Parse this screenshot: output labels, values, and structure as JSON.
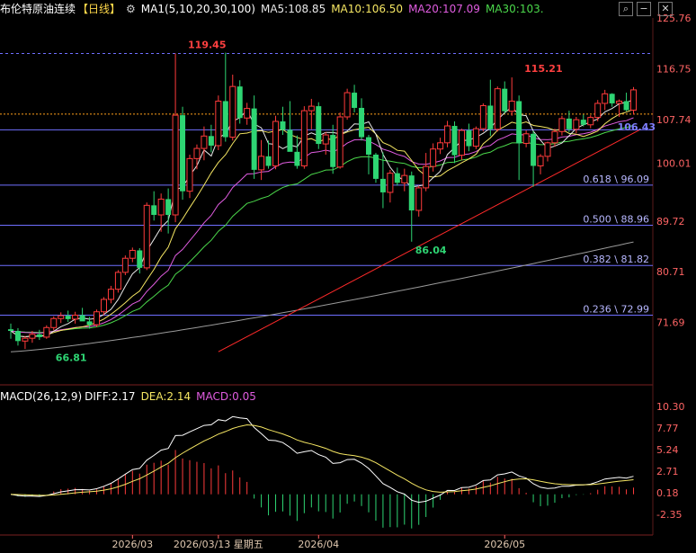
{
  "header": {
    "title": "布伦特原油连续",
    "period": "【日线】",
    "ma_indicator": "MA1(5,10,20,30,100)",
    "ma5": "MA5:108.85",
    "ma10": "MA10:106.50",
    "ma20": "MA20:107.09",
    "ma30": "MA30:103.",
    "macd_indicator": "MACD(26,12,9)",
    "diff": "DIFF:2.17",
    "dea": "DEA:2.14",
    "macd": "MACD:0.05"
  },
  "colors": {
    "up": "#ff3b3b",
    "down": "#2ed573",
    "ma5": "#e8e8e8",
    "ma10": "#f5e663",
    "ma20": "#e05ce0",
    "ma30": "#4bd84b",
    "ma100": "#9a9a9a",
    "fib": "#6f6fff",
    "dashed": "#ff9f1a",
    "trend": "#ff2a2a",
    "axis": "#ff6464"
  },
  "chart_data": [
    {
      "type": "candlestick",
      "y_axis_labels": [
        "125.76",
        "116.75",
        "107.74",
        "100.01",
        "89.72",
        "80.71",
        "71.69"
      ],
      "x_axis_labels": [
        "2026/03",
        "2026/03/13 星期五",
        "2026/04",
        "2026/05"
      ],
      "annotations": [
        {
          "text": "119.45",
          "x": 24,
          "y": 119.45,
          "color": "#ff4040"
        },
        {
          "text": "115.21",
          "x": 71,
          "y": 115.21,
          "color": "#ff4040"
        },
        {
          "text": "86.04",
          "x": 56,
          "y": 86.04,
          "color": "#2ed573"
        },
        {
          "text": "66.81",
          "x": 5,
          "y": 66.81,
          "color": "#2ed573"
        },
        {
          "text": "106.43",
          "x": 85,
          "y": 106.43,
          "color": "#7f7fff"
        }
      ],
      "fib_levels": [
        {
          "ratio": "0.618",
          "price": 96.09,
          "label": "0.618 \\ 96.09"
        },
        {
          "ratio": "0.500",
          "price": 88.96,
          "label": "0.500 \\ 88.96"
        },
        {
          "ratio": "0.382",
          "price": 81.82,
          "label": "0.382 \\ 81.82"
        },
        {
          "ratio": "0.236",
          "price": 72.99,
          "label": "0.236 \\ 72.99"
        }
      ],
      "reference_lines": {
        "high_line": 119.45,
        "dashed_line": 108.7,
        "upper_fib_line": 105.9
      },
      "trendline": [
        {
          "x": 29,
          "y": 66.5
        },
        {
          "x": 88,
          "y": 106.0
        }
      ],
      "candles": [
        [
          70.5,
          71.5,
          68.8,
          70.2
        ],
        [
          70.2,
          70.7,
          67.6,
          68.4
        ],
        [
          68.4,
          69.3,
          67.0,
          68.9
        ],
        [
          68.9,
          70.2,
          68.1,
          69.6
        ],
        [
          69.6,
          70.4,
          68.6,
          69.1
        ],
        [
          69.1,
          71.2,
          68.8,
          70.8
        ],
        [
          70.8,
          72.8,
          70.3,
          72.4
        ],
        [
          72.4,
          73.5,
          71.6,
          72.9
        ],
        [
          72.9,
          73.8,
          71.8,
          72.3
        ],
        [
          72.3,
          73.6,
          71.5,
          73.0
        ],
        [
          73.0,
          74.3,
          72.2,
          71.9
        ],
        [
          71.9,
          72.7,
          70.6,
          71.3
        ],
        [
          71.3,
          74.0,
          70.9,
          73.6
        ],
        [
          73.6,
          76.2,
          73.0,
          75.8
        ],
        [
          75.8,
          78.2,
          75.1,
          77.6
        ],
        [
          77.6,
          81.0,
          77.0,
          80.6
        ],
        [
          80.6,
          83.6,
          80.1,
          83.1
        ],
        [
          83.1,
          85.0,
          82.4,
          84.5
        ],
        [
          84.5,
          84.9,
          80.4,
          81.4
        ],
        [
          81.4,
          93.0,
          81.0,
          92.5
        ],
        [
          92.5,
          95.0,
          89.8,
          90.8
        ],
        [
          90.8,
          94.6,
          87.8,
          93.6
        ],
        [
          93.6,
          95.5,
          87.5,
          90.8
        ],
        [
          90.8,
          119.45,
          89.5,
          108.5
        ],
        [
          108.5,
          110.0,
          93.5,
          95.0
        ],
        [
          95.0,
          101.5,
          93.8,
          100.8
        ],
        [
          100.8,
          103.3,
          98.9,
          102.6
        ],
        [
          102.6,
          106.5,
          100.5,
          104.8
        ],
        [
          104.8,
          106.8,
          101.9,
          103.1
        ],
        [
          103.1,
          112.0,
          102.3,
          111.0
        ],
        [
          111.0,
          119.6,
          103.8,
          104.6
        ],
        [
          104.6,
          115.7,
          104.0,
          113.6
        ],
        [
          113.6,
          114.7,
          107.0,
          108.0
        ],
        [
          108.0,
          110.7,
          106.8,
          109.7
        ],
        [
          109.7,
          112.0,
          97.2,
          98.8
        ],
        [
          98.8,
          104.1,
          97.0,
          101.2
        ],
        [
          101.2,
          104.0,
          99.0,
          99.5
        ],
        [
          99.5,
          108.4,
          98.9,
          107.4
        ],
        [
          107.4,
          110.0,
          105.0,
          105.9
        ],
        [
          105.9,
          111.0,
          103.3,
          102.0
        ],
        [
          102.0,
          104.9,
          99.0,
          99.5
        ],
        [
          99.5,
          110.1,
          99.0,
          109.3
        ],
        [
          109.3,
          111.4,
          106.0,
          110.1
        ],
        [
          110.1,
          110.8,
          102.5,
          103.4
        ],
        [
          103.4,
          105.5,
          101.5,
          105.0
        ],
        [
          105.0,
          106.8,
          98.1,
          99.3
        ],
        [
          99.3,
          109.0,
          99.0,
          108.2
        ],
        [
          108.2,
          113.2,
          107.7,
          112.5
        ],
        [
          112.5,
          113.9,
          109.0,
          109.8
        ],
        [
          109.8,
          111.5,
          104.0,
          104.6
        ],
        [
          104.6,
          105.0,
          98.0,
          101.5
        ],
        [
          101.5,
          101.8,
          96.5,
          97.2
        ],
        [
          97.2,
          101.9,
          92.0,
          94.8
        ],
        [
          94.8,
          98.8,
          93.0,
          98.2
        ],
        [
          98.2,
          99.2,
          96.0,
          96.5
        ],
        [
          96.5,
          99.0,
          95.0,
          97.8
        ],
        [
          97.8,
          98.5,
          86.04,
          91.6
        ],
        [
          91.6,
          96.0,
          90.5,
          95.6
        ],
        [
          95.6,
          101.8,
          95.0,
          99.4
        ],
        [
          99.4,
          103.5,
          98.5,
          102.5
        ],
        [
          102.5,
          104.5,
          101.6,
          103.6
        ],
        [
          103.6,
          107.5,
          102.8,
          106.6
        ],
        [
          106.6,
          107.4,
          100.0,
          101.4
        ],
        [
          101.4,
          106.1,
          100.5,
          105.8
        ],
        [
          105.8,
          107.0,
          102.1,
          103.0
        ],
        [
          103.0,
          106.5,
          102.5,
          106.1
        ],
        [
          106.1,
          110.6,
          105.6,
          110.2
        ],
        [
          110.2,
          114.8,
          104.8,
          106.0
        ],
        [
          106.0,
          113.6,
          105.6,
          113.2
        ],
        [
          113.2,
          114.5,
          108.8,
          109.2
        ],
        [
          109.2,
          115.21,
          108.4,
          111.0
        ],
        [
          111.0,
          112.0,
          97.0,
          103.5
        ],
        [
          103.5,
          105.8,
          102.8,
          105.2
        ],
        [
          105.2,
          105.7,
          95.8,
          99.5
        ],
        [
          99.5,
          101.6,
          98.0,
          101.2
        ],
        [
          101.2,
          103.8,
          100.3,
          103.6
        ],
        [
          103.6,
          106.1,
          102.9,
          105.6
        ],
        [
          105.6,
          108.4,
          104.9,
          107.9
        ],
        [
          107.9,
          109.3,
          105.5,
          106.0
        ],
        [
          106.0,
          108.2,
          105.3,
          107.7
        ],
        [
          107.7,
          108.6,
          106.5,
          106.8
        ],
        [
          106.8,
          108.5,
          106.2,
          108.1
        ],
        [
          108.1,
          111.2,
          107.4,
          110.6
        ],
        [
          110.6,
          113.0,
          109.4,
          112.3
        ],
        [
          112.3,
          112.4,
          110.0,
          110.6
        ],
        [
          110.6,
          111.3,
          108.2,
          111.0
        ],
        [
          111.0,
          112.5,
          109.2,
          109.4
        ],
        [
          109.4,
          113.5,
          108.6,
          113.0
        ]
      ]
    },
    {
      "type": "bar",
      "y_axis_labels": [
        "10.30",
        "7.77",
        "5.24",
        "2.71",
        "0.18",
        "-2.35"
      ]
    }
  ]
}
